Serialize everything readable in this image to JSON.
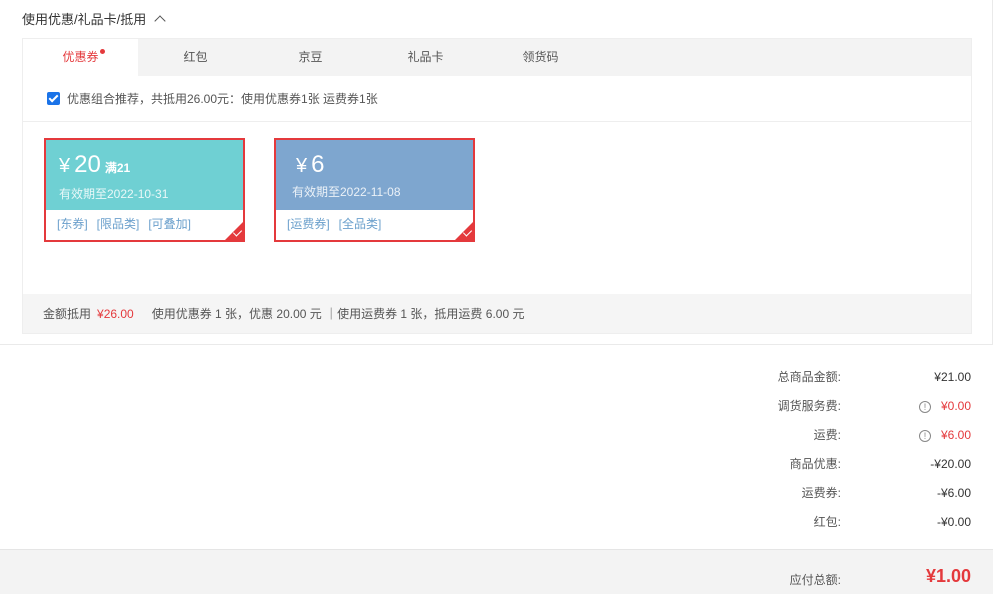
{
  "section": {
    "title": "使用优惠/礼品卡/抵用"
  },
  "tabs": [
    {
      "label": "优惠券"
    },
    {
      "label": "红包"
    },
    {
      "label": "京豆"
    },
    {
      "label": "礼品卡"
    },
    {
      "label": "领货码"
    }
  ],
  "combo": {
    "text": "优惠组合推荐，共抵用26.00元：使用优惠券1张 运费券1张"
  },
  "coupons": [
    {
      "yen": "¥",
      "amount": "20",
      "condition": "满21",
      "expiry": "有效期至2022-10-31",
      "tags": [
        "[东券]",
        "[限品类]",
        "[可叠加]"
      ],
      "color": "#6fd0d3"
    },
    {
      "yen": "¥",
      "amount": "6",
      "condition": "",
      "expiry": "有效期至2022-11-08",
      "tags": [
        "[运费券]",
        "[全品类]"
      ],
      "color": "#7ea6cf"
    }
  ],
  "footer": {
    "label": "金额抵用",
    "amount": "¥26.00",
    "detail": "使用优惠券 1 张，优惠 20.00 元 ｜使用运费券 1 张，抵用运费 6.00 元"
  },
  "summary": [
    {
      "label": "总商品金额:",
      "value": "¥21.00",
      "icon": false,
      "highlight": false
    },
    {
      "label": "调货服务费:",
      "value": "¥0.00",
      "icon": true,
      "highlight": true
    },
    {
      "label": "运费:",
      "value": "¥6.00",
      "icon": true,
      "highlight": true
    },
    {
      "label": "商品优惠:",
      "value": "-¥20.00",
      "icon": false,
      "highlight": false
    },
    {
      "label": "运费券:",
      "value": "-¥6.00",
      "icon": false,
      "highlight": false
    },
    {
      "label": "红包:",
      "value": "-¥0.00",
      "icon": false,
      "highlight": false
    }
  ],
  "total": {
    "label": "应付总额:",
    "value": "¥1.00"
  },
  "colors": {
    "accent": "#e4393c",
    "teal": "#6fd0d3",
    "blue": "#7ea6cf"
  }
}
